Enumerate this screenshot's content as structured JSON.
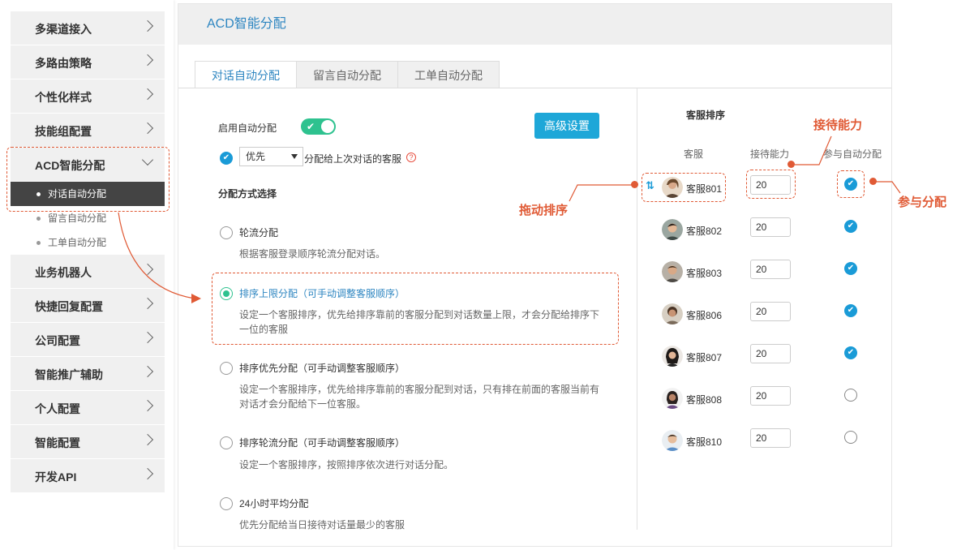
{
  "sidebar": {
    "items": [
      {
        "label": "多渠道接入"
      },
      {
        "label": "多路由策略"
      },
      {
        "label": "个性化样式"
      },
      {
        "label": "技能组配置"
      },
      {
        "label": "ACD智能分配"
      },
      {
        "label": "业务机器人"
      },
      {
        "label": "快捷回复配置"
      },
      {
        "label": "公司配置"
      },
      {
        "label": "智能推广辅助"
      },
      {
        "label": "个人配置"
      },
      {
        "label": "智能配置"
      },
      {
        "label": "开发API"
      }
    ],
    "sub_items": [
      {
        "label": "对话自动分配"
      },
      {
        "label": "留言自动分配"
      },
      {
        "label": "工单自动分配"
      }
    ]
  },
  "header": {
    "title": "ACD智能分配"
  },
  "tabs": [
    {
      "label": "对话自动分配"
    },
    {
      "label": "留言自动分配"
    },
    {
      "label": "工单自动分配"
    }
  ],
  "settings": {
    "enable_label": "启用自动分配",
    "advanced_button": "高级设置",
    "priority_select": "优先",
    "assign_last_label": "分配给上次对话的客服",
    "help_icon_text": "?",
    "mode_heading": "分配方式选择"
  },
  "options": [
    {
      "title": "轮流分配",
      "desc": "根据客服登录顺序轮流分配对话。"
    },
    {
      "title": "排序上限分配（可手动调整客服顺序）",
      "desc": "设定一个客服排序，优先给排序靠前的客服分配到对话数量上限，才会分配给排序下一位的客服"
    },
    {
      "title": "排序优先分配（可手动调整客服顺序）",
      "desc": "设定一个客服排序，优先给排序靠前的客服分配到对话，只有排在前面的客服当前有对话才会分配给下一位客服。"
    },
    {
      "title": "排序轮流分配（可手动调整客服顺序）",
      "desc": "设定一个客服排序，按照排序依次进行对话分配。"
    },
    {
      "title": "24小时平均分配",
      "desc": "优先分配给当日接待对话量最少的客服"
    }
  ],
  "ranking": {
    "title": "客服排序",
    "col_agent": "客服",
    "col_capacity": "接待能力",
    "col_participate": "参与自动分配",
    "agents": [
      {
        "name": "客服801",
        "capacity": "20",
        "participate": true
      },
      {
        "name": "客服802",
        "capacity": "20",
        "participate": true
      },
      {
        "name": "客服803",
        "capacity": "20",
        "participate": true
      },
      {
        "name": "客服806",
        "capacity": "20",
        "participate": true
      },
      {
        "name": "客服807",
        "capacity": "20",
        "participate": true
      },
      {
        "name": "客服808",
        "capacity": "20",
        "participate": false
      },
      {
        "name": "客服810",
        "capacity": "20",
        "participate": false
      }
    ]
  },
  "annotations": {
    "drag": "拖动排序",
    "capacity": "接待能力",
    "participate": "参与分配"
  },
  "colors": {
    "accent": "#1a9bd7",
    "toggle": "#2ec28f",
    "annotation": "#e05a35"
  }
}
